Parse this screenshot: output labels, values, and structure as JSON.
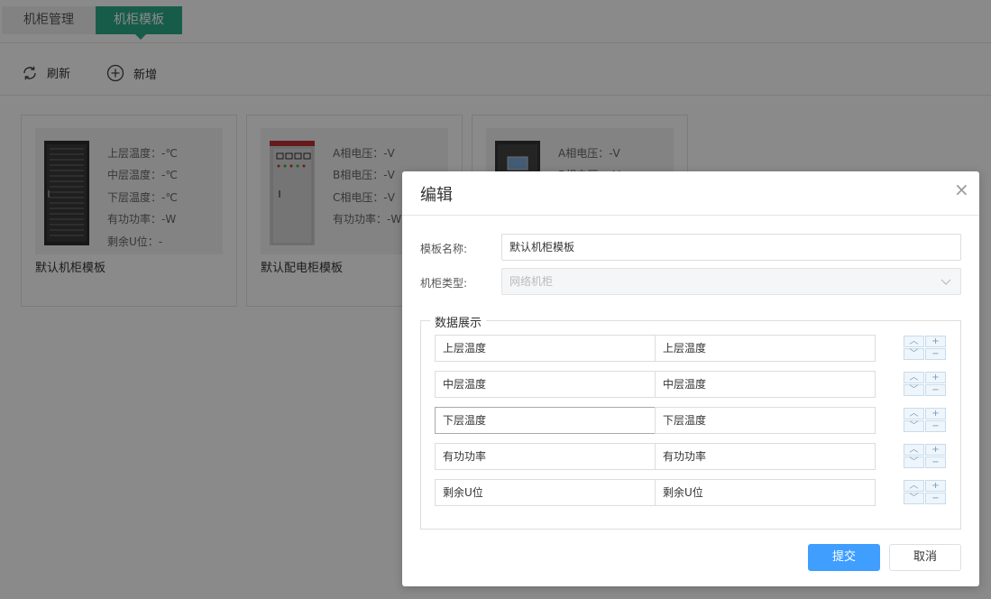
{
  "tabs": [
    {
      "label": "机柜管理"
    },
    {
      "label": "机柜模板"
    }
  ],
  "toolbar": {
    "refresh_label": "刷新",
    "add_label": "新增"
  },
  "cards": [
    {
      "name": "默认机柜模板",
      "params": [
        "上层温度：-℃",
        "中层温度：-℃",
        "下层温度：-℃",
        "有功功率：-W",
        "剩余U位：-"
      ]
    },
    {
      "name": "默认配电柜模板",
      "params": [
        "A相电压：-V",
        "B相电压：-V",
        "C相电压：-V",
        "有功功率：-W"
      ]
    },
    {
      "name": "",
      "params": [
        "A相电压：-V",
        "B相电压：-V"
      ]
    }
  ],
  "modal": {
    "title": "编辑",
    "template_name_label": "模板名称:",
    "template_name_value": "默认机柜模板",
    "cabinet_type_label": "机柜类型:",
    "cabinet_type_value": "网络机柜",
    "section_title": "数据展示",
    "rows": [
      {
        "field": "上层温度",
        "display": "上层温度"
      },
      {
        "field": "中层温度",
        "display": "中层温度"
      },
      {
        "field": "下层温度",
        "display": "下层温度"
      },
      {
        "field": "有功功率",
        "display": "有功功率"
      },
      {
        "field": "剩余U位",
        "display": "剩余U位"
      }
    ],
    "submit_label": "提交",
    "cancel_label": "取消"
  },
  "colors": {
    "active_tab": "#2cab88",
    "primary_button": "#409eff"
  }
}
